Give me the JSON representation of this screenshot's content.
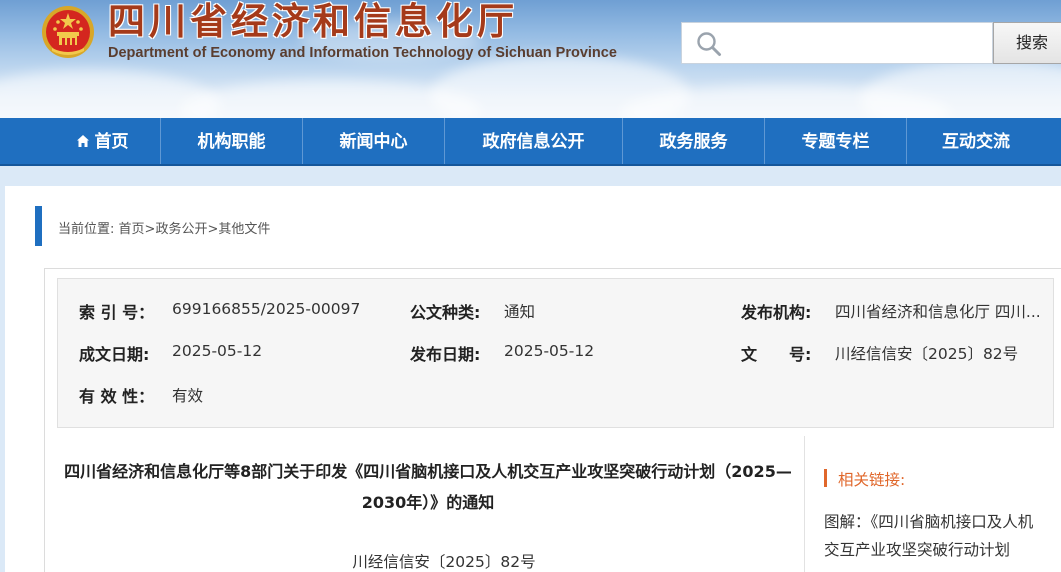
{
  "header": {
    "site_title": "四川省经济和信息化厅",
    "site_subtitle": "Department of Economy and Information Technology of Sichuan Province",
    "search_placeholder": "",
    "search_button": "搜索"
  },
  "nav": {
    "items": [
      {
        "label": "首页"
      },
      {
        "label": "机构职能"
      },
      {
        "label": "新闻中心"
      },
      {
        "label": "政府信息公开"
      },
      {
        "label": "政务服务"
      },
      {
        "label": "专题专栏"
      },
      {
        "label": "互动交流"
      }
    ]
  },
  "breadcrumb": {
    "prefix": "当前位置:",
    "items": [
      "首页",
      "政务公开",
      "其他文件"
    ],
    "separator": ">"
  },
  "info": {
    "index_label": "索 引 号：",
    "index_value": "699166855/2025-00097",
    "type_label": "公文种类:",
    "type_value": "通知",
    "issuer_label": "发布机构:",
    "issuer_value": "四川省经济和信息化厅 四川...",
    "created_label": "成文日期:",
    "created_value": "2025-05-12",
    "published_label": "发布日期:",
    "published_value": "2025-05-12",
    "docno_label": "文　　号:",
    "docno_value": "川经信信安〔2025〕82号",
    "validity_label": "有 效 性：",
    "validity_value": "有效"
  },
  "article": {
    "title": "四川省经济和信息化厅等8部门关于印发《四川省脑机接口及人机交互产业攻坚突破行动计划（2025—2030年）》的通知",
    "doc_number": "川经信信安〔2025〕82号"
  },
  "related": {
    "title": "相关链接:",
    "links": [
      "图解：《四川省脑机接口及人机交互产业攻坚突破行动计划"
    ]
  },
  "colors": {
    "nav_bg": "#1f6fc0",
    "title_red": "#a53a1a",
    "accent_orange": "#e0672b",
    "page_bg": "#dbe9f7"
  },
  "icons": [
    "national-emblem-icon",
    "search-icon",
    "home-icon"
  ]
}
